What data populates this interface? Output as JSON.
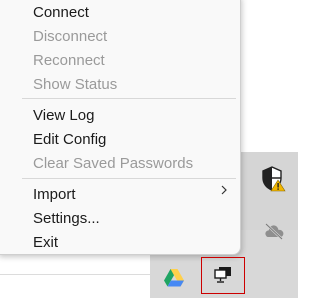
{
  "context_menu": {
    "items": [
      {
        "label": "Connect",
        "enabled": true
      },
      {
        "label": "Disconnect",
        "enabled": false
      },
      {
        "label": "Reconnect",
        "enabled": false
      },
      {
        "label": "Show Status",
        "enabled": false
      },
      {
        "label": "View Log",
        "enabled": true
      },
      {
        "label": "Edit Config",
        "enabled": true
      },
      {
        "label": "Clear Saved Passwords",
        "enabled": false
      },
      {
        "label": "Import",
        "enabled": true,
        "has_submenu": true
      },
      {
        "label": "Settings...",
        "enabled": true
      },
      {
        "label": "Exit",
        "enabled": true
      }
    ]
  },
  "tray_icons": [
    {
      "icon": "security-warning-icon"
    },
    {
      "icon": "cloud-offline-icon"
    },
    {
      "icon": "google-drive-icon"
    },
    {
      "icon": "vpn-network-icon",
      "highlighted": true,
      "highlight_color": "#cc0000"
    }
  ],
  "colors": {
    "menu_background": "#f9f9f9",
    "enabled_text": "#1b1b1b",
    "disabled_text": "#9a9a9a",
    "taskbar": "#d8d8d8",
    "warning": "#f2b600"
  }
}
